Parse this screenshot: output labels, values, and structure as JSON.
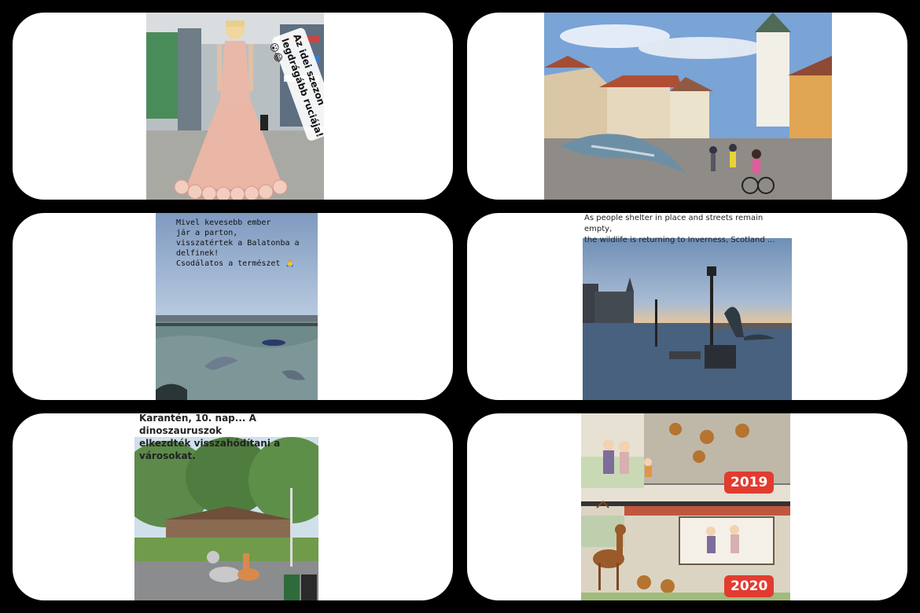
{
  "panels": {
    "p1": {
      "sticker_text": "Az idei szezon\nlegdrágább ruciája! 😮😂"
    },
    "p2": {},
    "p3": {
      "caption": "Mivel kevesebb ember\njár a parton,\nvisszatértek a Balatonba a delfinek!\nCsodálatos a természet 🙏"
    },
    "p4": {
      "caption": "As people shelter in place and streets remain empty,\nthe wildlife is returning to Inverness, Scotland ..."
    },
    "p5": {
      "caption": "Karantén, 10. nap... A dinoszauruszok\nelkezdték visszahódítani a városokat."
    },
    "p6": {
      "badge_top": "2019",
      "badge_bottom": "2020"
    }
  }
}
